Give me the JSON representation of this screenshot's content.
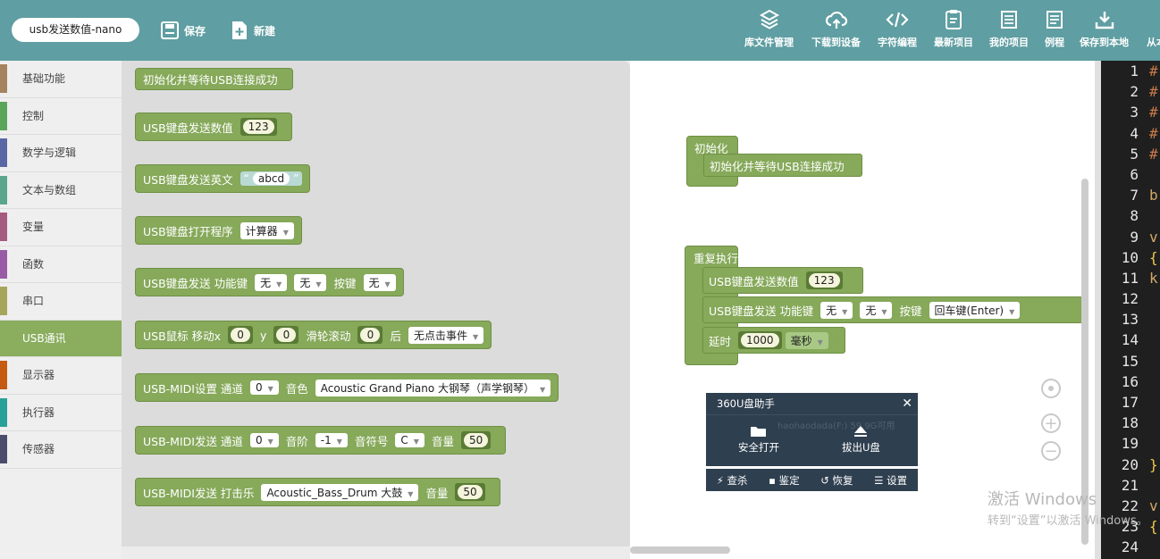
{
  "header": {
    "project_name": "usb发送数值-nano",
    "save_label": "保存",
    "new_label": "新建",
    "right_actions": [
      {
        "label": "库文件管理",
        "icon": "cube-icon"
      },
      {
        "label": "下载到设备",
        "icon": "cloud-upload-icon"
      },
      {
        "label": "字符编程",
        "icon": "code-icon"
      },
      {
        "label": "最新项目",
        "icon": "clipboard-icon"
      },
      {
        "label": "我的项目",
        "icon": "document-icon"
      },
      {
        "label": "例程",
        "icon": "list-document-icon"
      },
      {
        "label": "保存到本地",
        "icon": "download-icon"
      },
      {
        "label": "从本",
        "icon": "import-icon"
      }
    ]
  },
  "sidebar": {
    "items": [
      {
        "label": "基础功能",
        "color": "#a5835e"
      },
      {
        "label": "控制",
        "color": "#5ba55b"
      },
      {
        "label": "数学与逻辑",
        "color": "#5b67a5"
      },
      {
        "label": "文本与数组",
        "color": "#5ba58c"
      },
      {
        "label": "变量",
        "color": "#a55b80"
      },
      {
        "label": "函数",
        "color": "#995ba5"
      },
      {
        "label": "串口",
        "color": "#a5a55b"
      },
      {
        "label": "USB通讯",
        "color": "#8aad5e"
      },
      {
        "label": "显示器",
        "color": "#c55a11"
      },
      {
        "label": "执行器",
        "color": "#2aa198"
      },
      {
        "label": "传感器",
        "color": "#4b4b6b"
      }
    ]
  },
  "flyout": {
    "b1": {
      "text": "初始化并等待USB连接成功"
    },
    "b2": {
      "text": "USB键盘发送数值",
      "value": "123"
    },
    "b3": {
      "text": "USB键盘发送英文",
      "quote_open": "“",
      "value": "abcd",
      "quote_close": "”"
    },
    "b4": {
      "text": "USB键盘打开程序",
      "option": "计算器"
    },
    "b5": {
      "text": "USB键盘发送 功能键",
      "opt1": "无",
      "opt2": "无",
      "key_label": "按键",
      "opt3": "无"
    },
    "b6": {
      "text": "USB鼠标 移动x",
      "x": "0",
      "y_label": "y",
      "y": "0",
      "wheel_label": "滑轮滚动",
      "wheel": "0",
      "after_label": "后",
      "event": "无点击事件"
    },
    "b7": {
      "text": "USB-MIDI设置 通道",
      "channel": "0",
      "timbre_label": "音色",
      "timbre": "Acoustic Grand Piano 大钢琴（声学钢琴）"
    },
    "b8": {
      "text": "USB-MIDI发送 通道",
      "channel": "0",
      "octave_label": "音阶",
      "octave": "-1",
      "note_label": "音符号",
      "note": "C",
      "volume_label": "音量",
      "volume": "50"
    },
    "b9": {
      "text": "USB-MIDI发送 打击乐",
      "drum": "Acoustic_Bass_Drum 大鼓",
      "volume_label": "音量",
      "volume": "50"
    }
  },
  "workspace": {
    "init_block": {
      "title": "初始化",
      "inner": "初始化并等待USB连接成功"
    },
    "loop_block": {
      "title": "重复执行",
      "send_value": {
        "text": "USB键盘发送数值",
        "value": "123"
      },
      "send_func": {
        "text": "USB键盘发送 功能键",
        "opt1": "无",
        "opt2": "无",
        "key_label": "按键",
        "key": "回车键(Enter)"
      },
      "delay": {
        "text": "延时",
        "value": "1000",
        "unit": "毫秒"
      }
    }
  },
  "popup": {
    "title": "360U盘助手",
    "close": "✕",
    "drive_info": "haohaodada(F:) 59.9G可用",
    "open_label": "安全打开",
    "eject_label": "拔出U盘",
    "bar": [
      {
        "label": "查杀",
        "icon": "lightning-icon"
      },
      {
        "label": "鉴定",
        "icon": "lock-icon"
      },
      {
        "label": "恢复",
        "icon": "undo-icon"
      },
      {
        "label": "设置",
        "icon": "list-icon"
      }
    ]
  },
  "code": {
    "lines": [
      "1",
      "2",
      "3",
      "4",
      "5",
      "6",
      "7",
      "8",
      "9",
      "10",
      "11",
      "12",
      "13",
      "14",
      "15",
      "16",
      "17",
      "18",
      "19",
      "20",
      "21",
      "22",
      "23",
      "24"
    ],
    "snippets": [
      "#",
      "#",
      "#",
      "#",
      "#",
      "",
      "b",
      "",
      "v",
      "{",
      "k",
      "",
      "",
      "",
      "",
      "",
      "",
      "",
      "",
      "}",
      "",
      "v",
      "{",
      ""
    ]
  },
  "watermark": {
    "line1": "激活 Windows",
    "line2": "转到“设置”以激活 Windows。"
  }
}
